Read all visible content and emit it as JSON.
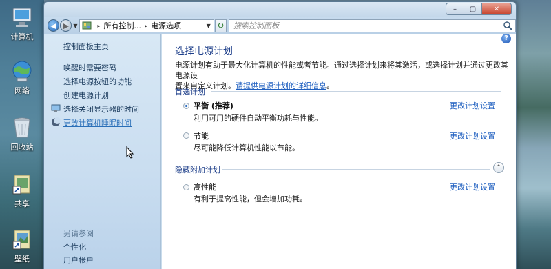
{
  "desktop": {
    "icons": [
      {
        "label": "计算机",
        "icon": "computer-icon"
      },
      {
        "label": "网络",
        "icon": "network-globe-icon"
      },
      {
        "label": "回收站",
        "icon": "recycle-bin-icon"
      },
      {
        "label": "共享",
        "icon": "shared-folder-shortcut-icon"
      },
      {
        "label": "壁纸",
        "icon": "wallpaper-shortcut-icon"
      }
    ]
  },
  "window": {
    "controls": {
      "minimize": "–",
      "maximize": "▢",
      "close": "✕"
    }
  },
  "navbar": {
    "address": {
      "root": "所有控制...",
      "current": "电源选项"
    },
    "search_placeholder": "搜索控制面板"
  },
  "sidebar": {
    "items": [
      {
        "label": "控制面板主页"
      },
      {
        "label": "唤醒时需要密码"
      },
      {
        "label": "选择电源按钮的功能"
      },
      {
        "label": "创建电源计划"
      },
      {
        "label": "选择关闭显示器的时间",
        "icon": "monitor-icon"
      },
      {
        "label": "更改计算机睡眠时间",
        "icon": "sleep-moon-icon",
        "hover": true
      }
    ],
    "see_also": {
      "heading": "另请参阅",
      "items": [
        {
          "label": "个性化"
        },
        {
          "label": "用户帐户"
        }
      ]
    }
  },
  "main": {
    "help": "?",
    "title": "选择电源计划",
    "desc_line1": "电源计划有助于最大化计算机的性能或者节能。通过选择计划来将其激活，或选择计划并通过更改其电源设",
    "desc_line2_text": "置来自定义计划。",
    "desc_link": "请提供电源计划的详细信息",
    "desc_end": "。",
    "preferred": {
      "heading": "首选计划",
      "plans": [
        {
          "name": "平衡 (推荐)",
          "desc": "利用可用的硬件自动平衡功耗与性能。",
          "link": "更改计划设置",
          "selected": true
        },
        {
          "name": "节能",
          "desc": "尽可能降低计算机性能以节能。",
          "link": "更改计划设置",
          "selected": false
        }
      ]
    },
    "hidden": {
      "heading": "隐藏附加计划",
      "plans": [
        {
          "name": "高性能",
          "desc": "有利于提高性能，但会增加功耗。",
          "link": "更改计划设置",
          "selected": false
        }
      ]
    }
  },
  "colors": {
    "link": "#2060c0",
    "heading": "#1e3f8a",
    "sidebar_bg": "#c9ddf0"
  }
}
